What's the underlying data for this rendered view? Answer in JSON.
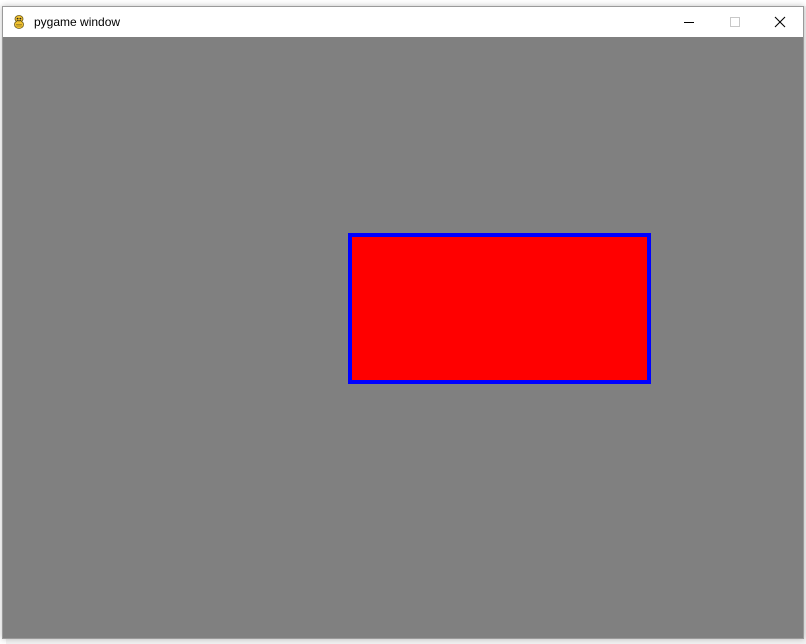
{
  "window": {
    "title": "pygame window",
    "icon": "pygame-snake-icon",
    "controls": {
      "minimize": "minimize-icon",
      "maximize": "maximize-icon",
      "close": "close-icon"
    }
  },
  "canvas": {
    "background_color": "#808080",
    "shape": {
      "type": "rectangle",
      "fill_color": "#ff0000",
      "border_color": "#0000ff"
    }
  }
}
